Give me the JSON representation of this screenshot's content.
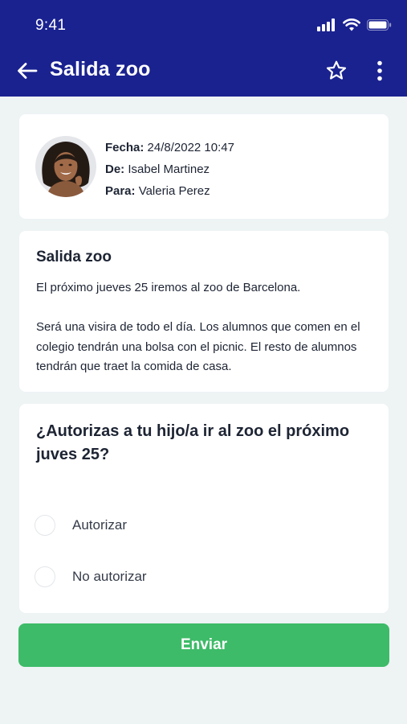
{
  "status_bar": {
    "time": "9:41"
  },
  "toolbar": {
    "title": "Salida zoo",
    "back_icon": "arrow-left-icon",
    "favorite_icon": "star-outline-icon",
    "more_icon": "more-vertical-icon"
  },
  "meta": {
    "date_label": "Fecha:",
    "date_value": "24/8/2022 10:47",
    "from_label": "De:",
    "from_value": "Isabel Martinez",
    "to_label": "Para:",
    "to_value": "Valeria Perez"
  },
  "message": {
    "title": "Salida zoo",
    "paragraph1": "El próximo jueves 25 iremos al zoo de Barcelona.",
    "paragraph2": "Será una visira de todo el día. Los alumnos que comen en el colegio tendrán una bolsa con el picnic. El resto de alumnos tendrán que traet la comida de casa."
  },
  "question": {
    "text": "¿Autorizas a tu hijo/a ir al zoo el próximo juves 25?",
    "options": [
      {
        "label": "Autorizar",
        "selected": false
      },
      {
        "label": "No autorizar",
        "selected": false
      }
    ]
  },
  "submit": {
    "label": "Enviar"
  },
  "colors": {
    "header": "#1a2290",
    "background": "#eef3f4",
    "primary_button": "#3dbb68"
  }
}
